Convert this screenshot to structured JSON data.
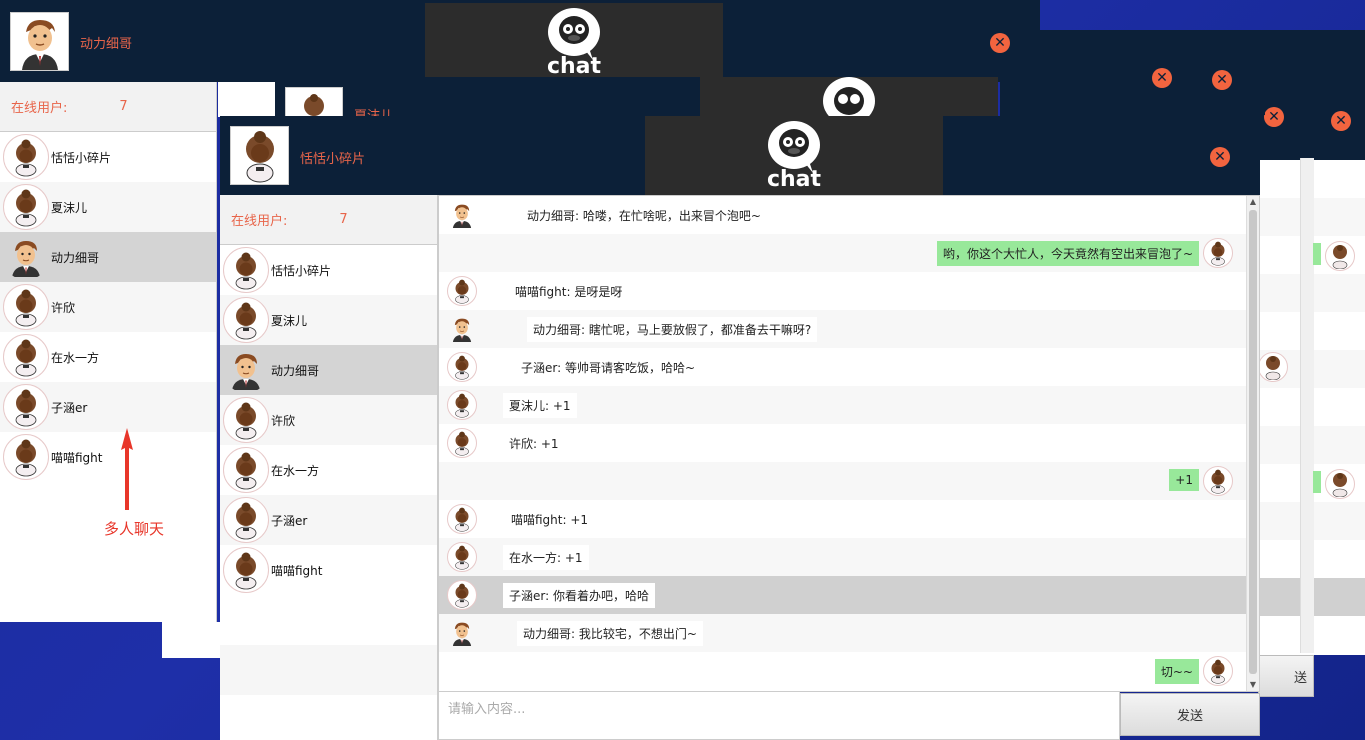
{
  "app": {
    "logo_text": "chat",
    "send_label": "发送",
    "input_placeholder": "请输入内容..."
  },
  "back_window": {
    "user_name": "动力细哥",
    "online_label": "在线用户:",
    "online_count": "7",
    "partial_name": "夏沫儿"
  },
  "front_window": {
    "user_name": "恬恬小碎片",
    "online_label": "在线用户:",
    "online_count": "7"
  },
  "users": [
    {
      "name": "恬恬小碎片",
      "avatar": "girl-avatar"
    },
    {
      "name": "夏沫儿",
      "avatar": "girl-avatar"
    },
    {
      "name": "动力细哥",
      "avatar": "boy-avatar"
    },
    {
      "name": "许欣",
      "avatar": "girl-avatar"
    },
    {
      "name": "在水一方",
      "avatar": "girl-avatar"
    },
    {
      "name": "子涵er",
      "avatar": "girl-avatar"
    },
    {
      "name": "喵喵fight",
      "avatar": "girl-avatar"
    }
  ],
  "annotation": {
    "text": "多人聊天",
    "color": "#e8362a"
  },
  "messages": [
    {
      "text": "动力细哥: 哈喽，在忙啥呢，出来冒个泡吧~",
      "mine": false,
      "avatar": "boy-avatar"
    },
    {
      "text": "哟，你这个大忙人，今天竟然有空出来冒泡了~",
      "mine": true,
      "avatar": "girl-avatar"
    },
    {
      "text": "喵喵fight: 是呀是呀",
      "mine": false,
      "avatar": "girl-avatar"
    },
    {
      "text": "动力细哥: 瞎忙呢，马上要放假了，都准备去干嘛呀?",
      "mine": false,
      "avatar": "boy-avatar"
    },
    {
      "text": "子涵er: 等帅哥请客吃饭，哈哈~",
      "mine": false,
      "avatar": "girl-avatar"
    },
    {
      "text": "夏沫儿: +1",
      "mine": false,
      "avatar": "girl-avatar"
    },
    {
      "text": "许欣: +1",
      "mine": false,
      "avatar": "girl-avatar"
    },
    {
      "text": "+1",
      "mine": true,
      "avatar": "girl-avatar"
    },
    {
      "text": "喵喵fight: +1",
      "mine": false,
      "avatar": "girl-avatar"
    },
    {
      "text": "在水一方: +1",
      "mine": false,
      "avatar": "girl-avatar"
    },
    {
      "text": "子涵er: 你看着办吧，哈哈",
      "mine": false,
      "avatar": "girl-avatar",
      "highlighted": true
    },
    {
      "text": "动力细哥: 我比较宅，不想出门~",
      "mine": false,
      "avatar": "boy-avatar"
    },
    {
      "text": "切~~",
      "mine": true,
      "avatar": "girl-avatar"
    }
  ],
  "colors": {
    "header_bg": "#0c2038",
    "accent": "#e8654a",
    "my_bubble": "#98e89a",
    "close_btn": "#f2643f",
    "desktop_bg": "#1e2fa8"
  }
}
